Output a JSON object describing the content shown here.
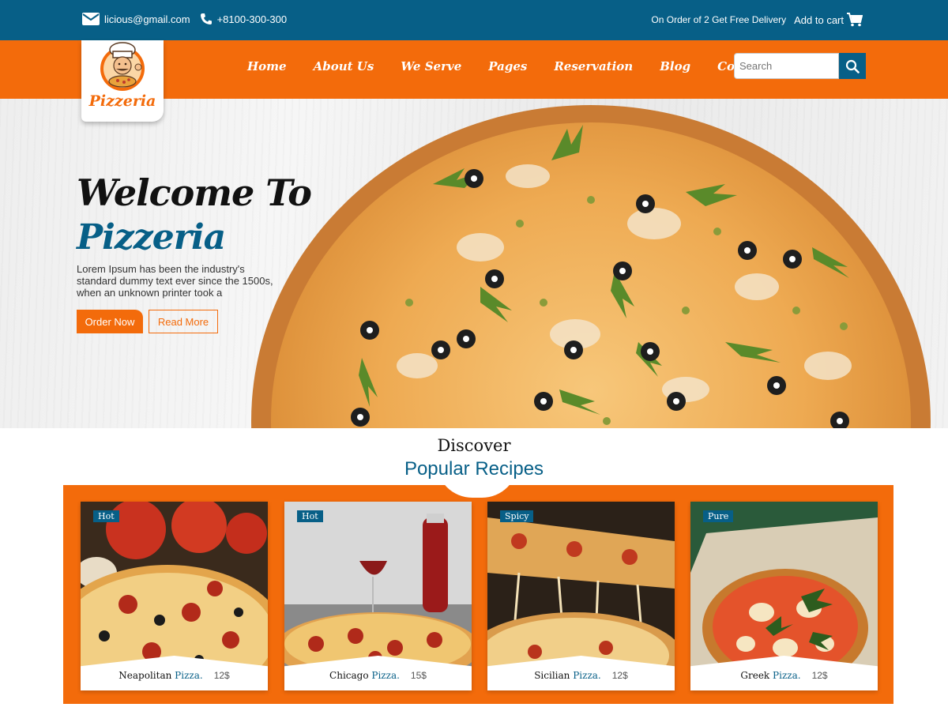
{
  "topbar": {
    "email": "licious@gmail.com",
    "phone": "+8100-300-300",
    "offer": "On Order of 2 Get Free Delivery",
    "cart": "Add to cart"
  },
  "logo": {
    "text": "Pizzeria"
  },
  "nav": {
    "items": [
      "Home",
      "About Us",
      "We Serve",
      "Pages",
      "Reservation",
      "Blog",
      "Contact Us"
    ]
  },
  "search": {
    "placeholder": "Search"
  },
  "hero": {
    "title_line1": "Welcome To",
    "title_line2": "Pizzeria",
    "description": "Lorem Ipsum has been the industry's standard dummy text ever since the 1500s, when an unknown printer took a",
    "order_button": "Order Now",
    "read_button": "Read More"
  },
  "section": {
    "kicker": "Discover",
    "title": "Popular Recipes"
  },
  "recipes": [
    {
      "tag": "Hot",
      "name": "Neapolitan",
      "suffix": "Pizza.",
      "price": "12$"
    },
    {
      "tag": "Hot",
      "name": "Chicago",
      "suffix": "Pizza.",
      "price": "15$"
    },
    {
      "tag": "Spicy",
      "name": "Sicilian",
      "suffix": "Pizza.",
      "price": "12$"
    },
    {
      "tag": "Pure",
      "name": "Greek",
      "suffix": "Pizza.",
      "price": "12$"
    }
  ],
  "colors": {
    "primary": "#075f87",
    "accent": "#f36b0b"
  },
  "icons": [
    "envelope-icon",
    "phone-icon",
    "cart-icon",
    "search-icon"
  ]
}
